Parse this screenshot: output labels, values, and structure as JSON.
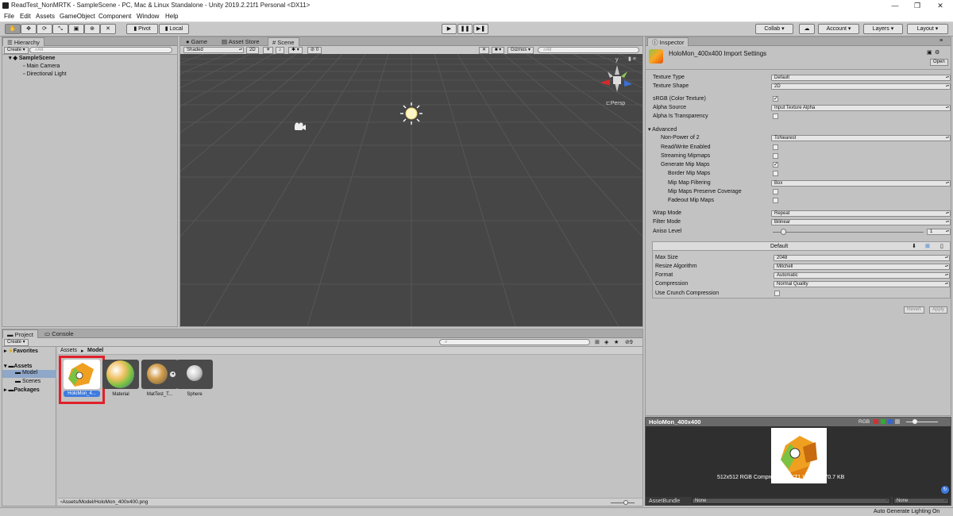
{
  "window": {
    "title": "ReadTest_NonMRTK - SampleScene - PC, Mac & Linux Standalone - Unity 2019.2.21f1 Personal <DX11>",
    "minimize": "—",
    "maximize": "❐",
    "close": "✕"
  },
  "menu": [
    "File",
    "Edit",
    "Assets",
    "GameObject",
    "Component",
    "Window",
    "Help"
  ],
  "toolbar": {
    "pivot": "Pivot",
    "local": "Local",
    "collab": "Collab ▾",
    "account": "Account",
    "layers": "Layers",
    "layout": "Layout",
    "play_icons": [
      "play-icon",
      "pause-icon",
      "step-icon"
    ]
  },
  "hierarchy": {
    "tab": "Hierarchy",
    "create": "Create ▾",
    "search_placeholder": "All",
    "scene": "SampleScene",
    "items": [
      "Main Camera",
      "Directional Light"
    ]
  },
  "scene_view": {
    "tabs": [
      "Game",
      "Asset Store",
      "Scene"
    ],
    "active_tab": "Scene",
    "shading": "Shaded",
    "mode_2d": "2D",
    "fx_count": "0",
    "gizmos": "Gizmos ▾",
    "search_placeholder": "All",
    "persp_label": "Persp",
    "gizmo_y": "y"
  },
  "inspector": {
    "tab": "Inspector",
    "title": "HoloMon_400x400 Import Settings",
    "open": "Open",
    "fields": {
      "texture_type": {
        "label": "Texture Type",
        "value": "Default"
      },
      "texture_shape": {
        "label": "Texture Shape",
        "value": "2D"
      },
      "srgb": {
        "label": "sRGB (Color Texture)",
        "checked": "✓"
      },
      "alpha_source": {
        "label": "Alpha Source",
        "value": "Input Texture Alpha"
      },
      "alpha_transparency": {
        "label": "Alpha Is Transparency",
        "checked": ""
      },
      "advanced": {
        "label": "Advanced"
      },
      "non_power": {
        "label": "Non-Power of 2",
        "value": "ToNearest"
      },
      "read_write": {
        "label": "Read/Write Enabled",
        "checked": ""
      },
      "streaming_mip": {
        "label": "Streaming Mipmaps",
        "checked": ""
      },
      "gen_mip": {
        "label": "Generate Mip Maps",
        "checked": "✓"
      },
      "border_mip": {
        "label": "Border Mip Maps",
        "checked": ""
      },
      "mip_filtering": {
        "label": "Mip Map Filtering",
        "value": "Box"
      },
      "mip_preserve": {
        "label": "Mip Maps Preserve Coverage",
        "checked": ""
      },
      "fadeout_mip": {
        "label": "Fadeout Mip Maps",
        "checked": ""
      },
      "wrap_mode": {
        "label": "Wrap Mode",
        "value": "Repeat"
      },
      "filter_mode": {
        "label": "Filter Mode",
        "value": "Bilinear"
      },
      "aniso": {
        "label": "Aniso Level",
        "value": "1"
      }
    },
    "platform": {
      "tab": "Default",
      "max_size": {
        "label": "Max Size",
        "value": "2048"
      },
      "resize": {
        "label": "Resize Algorithm",
        "value": "Mitchell"
      },
      "format": {
        "label": "Format",
        "value": "Automatic"
      },
      "compression": {
        "label": "Compression",
        "value": "Normal Quality"
      },
      "crunch": {
        "label": "Use Crunch Compression",
        "checked": ""
      }
    },
    "revert": "Revert",
    "apply": "Apply"
  },
  "preview": {
    "title": "HoloMon_400x400",
    "rgb": "RGB",
    "info": "512x512  RGB Compressed DXT1 UNorm  170.7 KB",
    "assetbundle_label": "AssetBundle",
    "assetbundle_value": "None",
    "variant_value": "None"
  },
  "project": {
    "tabs": [
      "Project",
      "Console"
    ],
    "create": "Create ▾",
    "tree": {
      "favorites": "Favorites",
      "assets": "Assets",
      "model": "Model",
      "scenes": "Scenes",
      "packages": "Packages"
    },
    "breadcrumb": [
      "Assets",
      "Model"
    ],
    "count": "9",
    "items": [
      {
        "label": "HoloMon_4..."
      },
      {
        "label": "Material"
      },
      {
        "label": "MatTest_T..."
      },
      {
        "label": "Sphere"
      }
    ],
    "path": "Assets/Model/HoloMon_400x400.png"
  },
  "status": "Auto Generate Lighting On",
  "colors": {
    "highlight": "#e0202a",
    "selected": "#3d7be0"
  }
}
